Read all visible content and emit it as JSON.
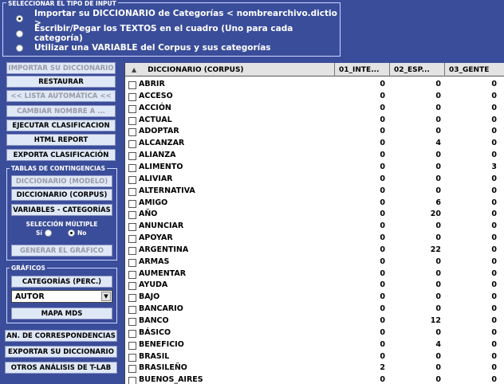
{
  "input_type": {
    "title": "SELECCIONAR EL TIPO DE INPUT",
    "options": [
      {
        "label": "Importar su DICCIONARIO de Categorías < nombrearchivo.dictio >",
        "selected": true
      },
      {
        "label": "Escribir/Pegar los TEXTOS en el cuadro (Uno para cada categoría)",
        "selected": false
      },
      {
        "label": "Utilizar una VARIABLE del Corpus y sus categorías",
        "selected": false
      }
    ]
  },
  "left_panel": {
    "import_dict": "IMPORTAR SU DICCIONARIO",
    "restore": "RESTAURAR",
    "auto_list": "<< LISTA AUTOMÁTICA <<",
    "rename": "CAMBIAR NOMBRE A ...",
    "run_classification": "EJECUTAR CLASIFICACION",
    "html_report": "HTML REPORT",
    "export_classification": "EXPORTA CLASIFICACIÓN",
    "contingency": {
      "title": "TABLAS DE CONTINGENCIAS",
      "dict_model": "DICCIONARIO (MODELO)",
      "dict_corpus": "DICCIONARIO (CORPUS)",
      "variables": "VARIABLES - CATEGORÍAS",
      "multi_label": "SELECCIÓN MÚLTIPLE",
      "yes": "Sí",
      "no": "No",
      "generate_chart": "GENERAR EL GRÁFICO"
    },
    "charts": {
      "title": "GRÁFICOS",
      "categories_perc": "CATEGORÍAS  (PERC.)",
      "combo_value": "AUTOR",
      "mds_map": "MAPA  MDS"
    },
    "correspondence": "AN. DE CORRESPONDENCIAS",
    "export_dict": "EXPORTAR SU DICCIONARIO",
    "other_analyses": "OTROS ANÁLISIS DE T-LAB"
  },
  "table": {
    "columns": [
      "DICCIONARIO (CORPUS)",
      "01_INTE...",
      "02_ESP...",
      "03_GENTE"
    ],
    "rows": [
      [
        "ABRIR",
        "0",
        "0",
        "0"
      ],
      [
        "ACCESO",
        "0",
        "0",
        "0"
      ],
      [
        "ACCIÓN",
        "0",
        "0",
        "0"
      ],
      [
        "ACTUAL",
        "0",
        "0",
        "0"
      ],
      [
        "ADOPTAR",
        "0",
        "0",
        "0"
      ],
      [
        "ALCANZAR",
        "0",
        "4",
        "0"
      ],
      [
        "ALIANZA",
        "0",
        "0",
        "0"
      ],
      [
        "ALIMENTO",
        "0",
        "0",
        "3"
      ],
      [
        "ALIVIAR",
        "0",
        "0",
        "0"
      ],
      [
        "ALTERNATIVA",
        "0",
        "0",
        "0"
      ],
      [
        "AMIGO",
        "0",
        "6",
        "0"
      ],
      [
        "AÑO",
        "0",
        "20",
        "0"
      ],
      [
        "ANUNCIAR",
        "0",
        "0",
        "0"
      ],
      [
        "APOYAR",
        "0",
        "0",
        "0"
      ],
      [
        "ARGENTINA",
        "0",
        "22",
        "0"
      ],
      [
        "ARMAS",
        "0",
        "0",
        "0"
      ],
      [
        "AUMENTAR",
        "0",
        "0",
        "0"
      ],
      [
        "AYUDA",
        "0",
        "0",
        "0"
      ],
      [
        "BAJO",
        "0",
        "0",
        "0"
      ],
      [
        "BANCARIO",
        "0",
        "0",
        "0"
      ],
      [
        "BANCO",
        "0",
        "12",
        "0"
      ],
      [
        "BÁSICO",
        "0",
        "0",
        "0"
      ],
      [
        "BENEFICIO",
        "0",
        "4",
        "0"
      ],
      [
        "BRASIL",
        "0",
        "0",
        "0"
      ],
      [
        "BRASILEÑO",
        "2",
        "0",
        "0"
      ],
      [
        "BUENOS_AIRES",
        "0",
        "0",
        "0"
      ]
    ]
  }
}
